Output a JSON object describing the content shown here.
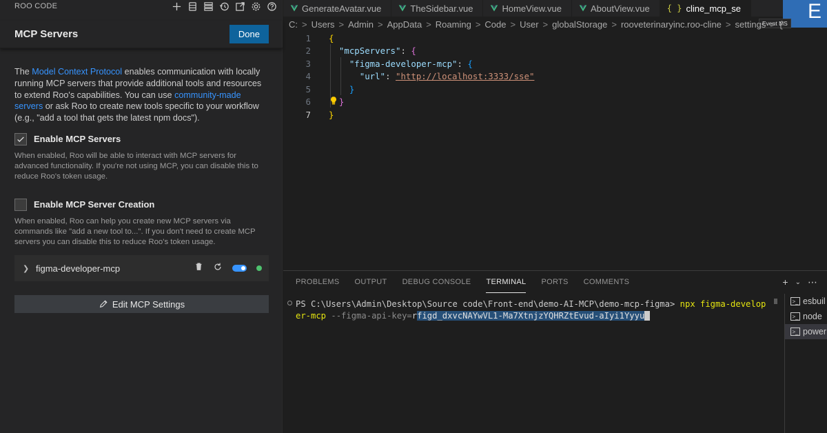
{
  "roo": {
    "title": "ROO CODE",
    "toolbar_icons": [
      "plus-icon",
      "database-icon",
      "server-list-icon",
      "history-icon",
      "popout-icon",
      "gear-icon",
      "help-icon"
    ]
  },
  "mcp": {
    "title": "MCP Servers",
    "done_label": "Done",
    "intro": {
      "t1": "The ",
      "link1": "Model Context Protocol",
      "t2": " enables communication with locally running MCP servers that provide additional tools and resources to extend Roo's capabilities. You can use ",
      "link2": "community-made servers",
      "t3": " or ask Roo to create new tools specific to your workflow (e.g., \"add a tool that gets the latest npm docs\")."
    },
    "enable_mcp": {
      "label": "Enable MCP Servers",
      "checked": true,
      "desc": "When enabled, Roo will be able to interact with MCP servers for advanced functionality. If you're not using MCP, you can disable this to reduce Roo's token usage."
    },
    "enable_creation": {
      "label": "Enable MCP Server Creation",
      "checked": false,
      "desc": "When enabled, Roo can help you create new MCP servers via commands like \"add a new tool to...\". If you don't need to create MCP servers you can disable this to reduce Roo's token usage."
    },
    "server": {
      "name": "figma-developer-mcp",
      "enabled": true,
      "status_color": "#4ec26e"
    },
    "edit_label": "Edit MCP Settings"
  },
  "editor": {
    "tabs": [
      {
        "label": "GenerateAvatar.vue",
        "type": "vue"
      },
      {
        "label": "TheSidebar.vue",
        "type": "vue"
      },
      {
        "label": "HomeView.vue",
        "type": "vue"
      },
      {
        "label": "AboutView.vue",
        "type": "vue"
      },
      {
        "label": "cline_mcp_se",
        "type": "json"
      }
    ],
    "badge_letter": "E",
    "badge_tooltip": "Event MS",
    "breadcrumb": [
      "C:",
      "Users",
      "Admin",
      "AppData",
      "Roaming",
      "Code",
      "User",
      "globalStorage",
      "rooveterinaryinc.roo-cline",
      "settings",
      "{} cli"
    ],
    "line_numbers": [
      "1",
      "2",
      "3",
      "4",
      "5",
      "6",
      "7"
    ],
    "current_line": "7",
    "code": {
      "l2_key": "\"mcpServers\"",
      "l3_key": "\"figma-developer-mcp\"",
      "l4_key": "\"url\"",
      "l4_val": "\"http://localhost:3333/sse\""
    }
  },
  "panel": {
    "tabs": [
      "PROBLEMS",
      "OUTPUT",
      "DEBUG CONSOLE",
      "TERMINAL",
      "PORTS",
      "COMMENTS"
    ],
    "active_tab": "TERMINAL",
    "terminal": {
      "prompt": "PS C:\\Users\\Admin\\Desktop\\Source code\\Front-end\\demo-AI-MCP\\demo-mcp-figma> ",
      "cmd1": "npx figma-develop",
      "cmd2": "er-mcp",
      "args": " --figma-api-key=",
      "selected": "figd_dxvcNAYwVL1-Ma7XtnjzYQHRZtEvud-aIyi1Yyyu",
      "first_char": "r"
    },
    "terminal_list": [
      "esbuil",
      "node",
      "power"
    ]
  }
}
